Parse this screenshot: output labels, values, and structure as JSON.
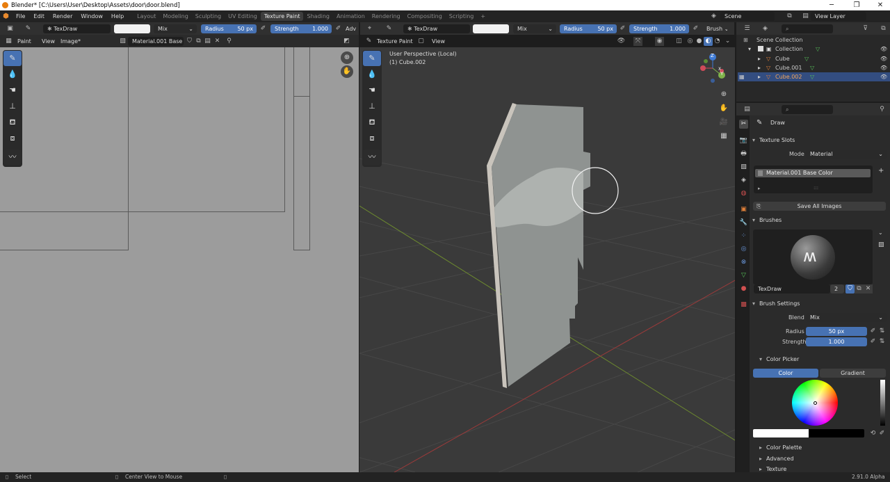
{
  "window": {
    "title": "Blender* [C:\\Users\\User\\Desktop\\Assets\\door\\door.blend]",
    "minimize": "─",
    "maximize": "❐",
    "close": "✕"
  },
  "menu": [
    "File",
    "Edit",
    "Render",
    "Window",
    "Help"
  ],
  "workspaces": [
    "Layout",
    "Modeling",
    "Sculpting",
    "UV Editing",
    "Texture Paint",
    "Shading",
    "Animation",
    "Rendering",
    "Compositing",
    "Scripting",
    "+"
  ],
  "active_workspace": "Texture Paint",
  "scene": {
    "name": "Scene",
    "view_layer": "View Layer"
  },
  "image_editor": {
    "brush_name": "TexDraw",
    "blend": "Mix",
    "radius_label": "Radius",
    "radius_value": "50 px",
    "strength_label": "Strength",
    "strength_value": "1.000",
    "advanced_label": "Adv",
    "mode": "Paint",
    "view_menu": "View",
    "image_menu": "Image*",
    "image_name": "Material.001 Base ..."
  },
  "viewport": {
    "brush_name": "TexDraw",
    "blend": "Mix",
    "radius_label": "Radius",
    "radius_value": "50 px",
    "strength_label": "Strength",
    "strength_value": "1.000",
    "brush_menu": "Brush",
    "mode": "Texture Paint",
    "view_menu": "View",
    "perspective": "User Perspective (Local)",
    "object": "(1) Cube.002",
    "gizmo": {
      "x": "X",
      "y": "Y",
      "z": "Z"
    }
  },
  "outliner": {
    "search_placeholder": "",
    "scene_collection": "Scene Collection",
    "collection": "Collection",
    "objects": [
      "Cube",
      "Cube.001",
      "Cube.002"
    ],
    "selected": "Cube.002"
  },
  "properties": {
    "active_tool": "Draw",
    "texture_slots": {
      "title": "Texture Slots",
      "mode_label": "Mode",
      "mode_value": "Material",
      "slot": "Material.001 Base Color",
      "save_all": "Save All Images"
    },
    "brushes": {
      "title": "Brushes",
      "name": "TexDraw",
      "users": "2"
    },
    "brush_settings": {
      "title": "Brush Settings",
      "blend_label": "Blend",
      "blend_value": "Mix",
      "radius_label": "Radius",
      "radius_value": "50 px",
      "strength_label": "Strength",
      "strength_value": "1.000"
    },
    "color_picker": {
      "title": "Color Picker",
      "tab_color": "Color",
      "tab_gradient": "Gradient"
    },
    "collapsed": [
      "Color Palette",
      "Advanced",
      "Texture"
    ]
  },
  "statusbar": {
    "select": "Select",
    "center_view": "Center View to Mouse",
    "version": "2.91.0 Alpha"
  },
  "colors": {
    "accent": "#4772b3",
    "selection": "#334d80",
    "object_orange": "#e0803a",
    "mesh_green": "#56c35a"
  }
}
